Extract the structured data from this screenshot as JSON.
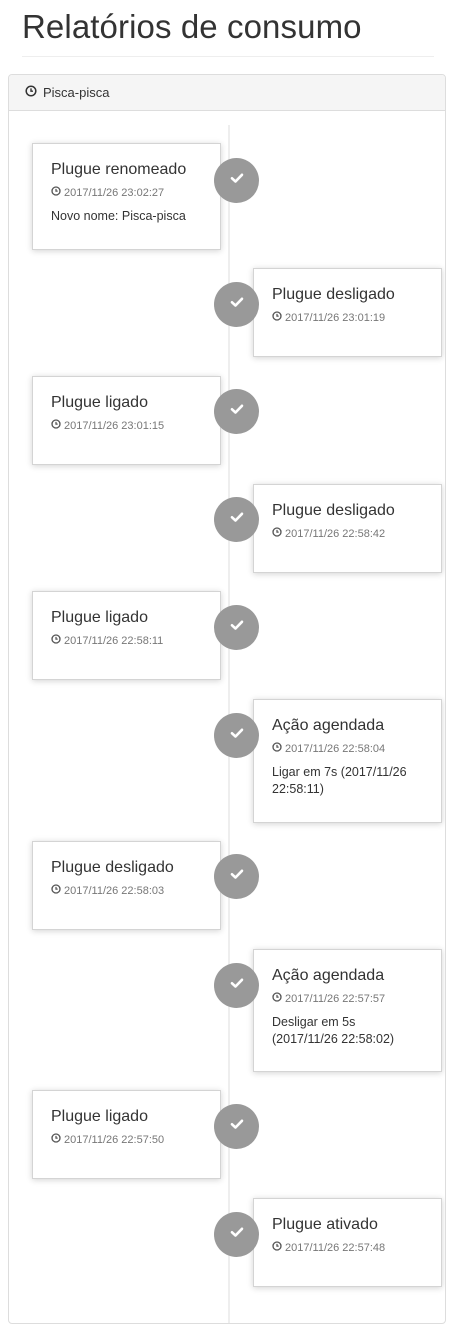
{
  "page": {
    "title": "Relatórios de consumo"
  },
  "panel": {
    "heading": "Pisca-pisca"
  },
  "events": [
    {
      "side": "left",
      "title": "Plugue renomeado",
      "time": "2017/11/26 23:02:27",
      "body": "Novo nome: Pisca-pisca"
    },
    {
      "side": "right",
      "title": "Plugue desligado",
      "time": "2017/11/26 23:01:19",
      "body": ""
    },
    {
      "side": "left",
      "title": "Plugue ligado",
      "time": "2017/11/26 23:01:15",
      "body": ""
    },
    {
      "side": "right",
      "title": "Plugue desligado",
      "time": "2017/11/26 22:58:42",
      "body": ""
    },
    {
      "side": "left",
      "title": "Plugue ligado",
      "time": "2017/11/26 22:58:11",
      "body": ""
    },
    {
      "side": "right",
      "title": "Ação agendada",
      "time": "2017/11/26 22:58:04",
      "body": "Ligar em 7s (2017/11/26 22:58:11)"
    },
    {
      "side": "left",
      "title": "Plugue desligado",
      "time": "2017/11/26 22:58:03",
      "body": ""
    },
    {
      "side": "right",
      "title": "Ação agendada",
      "time": "2017/11/26 22:57:57",
      "body": "Desligar em 5s (2017/11/26 22:58:02)"
    },
    {
      "side": "left",
      "title": "Plugue ligado",
      "time": "2017/11/26 22:57:50",
      "body": ""
    },
    {
      "side": "right",
      "title": "Plugue ativado",
      "time": "2017/11/26 22:57:48",
      "body": ""
    }
  ],
  "icons": {
    "heading": "clock-icon",
    "time": "clock-icon",
    "badge": "check-icon"
  },
  "colors": {
    "badge": "#999999",
    "muted": "#777777",
    "text": "#333333"
  }
}
